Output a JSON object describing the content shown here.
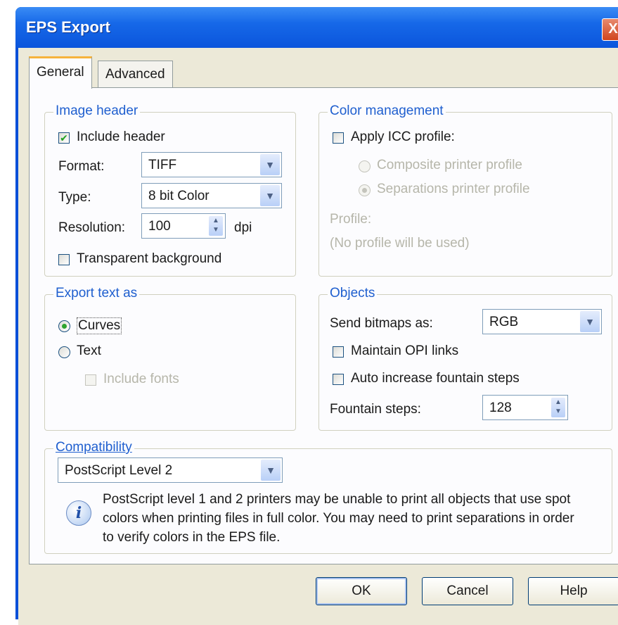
{
  "window": {
    "title": "EPS Export",
    "close_label": "X"
  },
  "tabs": [
    {
      "label": "General",
      "active": true
    },
    {
      "label": "Advanced",
      "active": false
    }
  ],
  "image_header": {
    "legend": "Image header",
    "include_header": {
      "label": "Include header",
      "checked": true
    },
    "format": {
      "label": "Format:",
      "value": "TIFF"
    },
    "type": {
      "label": "Type:",
      "value": "8 bit Color"
    },
    "resolution": {
      "label": "Resolution:",
      "value": "100",
      "unit": "dpi"
    },
    "transparent_bg": {
      "label": "Transparent background",
      "checked": false
    }
  },
  "color_management": {
    "legend": "Color management",
    "apply_icc": {
      "label": "Apply ICC profile:",
      "checked": false
    },
    "composite": {
      "label": "Composite printer profile",
      "checked": false
    },
    "separations": {
      "label": "Separations printer profile",
      "checked": true
    },
    "profile_label": "Profile:",
    "profile_value": "(No profile will be used)"
  },
  "export_text": {
    "legend": "Export text as",
    "curves": {
      "label": "Curves",
      "checked": true
    },
    "text": {
      "label": "Text",
      "checked": false
    },
    "include_fonts": {
      "label": "Include fonts",
      "checked": false
    }
  },
  "objects": {
    "legend": "Objects",
    "send_bitmaps": {
      "label": "Send bitmaps as:",
      "value": "RGB"
    },
    "maintain_opi": {
      "label": "Maintain OPI links",
      "checked": false
    },
    "auto_increase": {
      "label": "Auto increase fountain steps",
      "checked": false
    },
    "fountain_steps": {
      "label": "Fountain steps:",
      "value": "128"
    }
  },
  "compatibility": {
    "legend": "Compatibility",
    "value": "PostScript Level 2",
    "info_line1": "PostScript level 1 and 2 printers may be unable to print all objects that use spot",
    "info_line2": "colors when printing files in full color. You may need to print separations in order",
    "info_line3": "to verify colors in the EPS file."
  },
  "buttons": {
    "ok": "OK",
    "cancel": "Cancel",
    "help": "Help"
  }
}
